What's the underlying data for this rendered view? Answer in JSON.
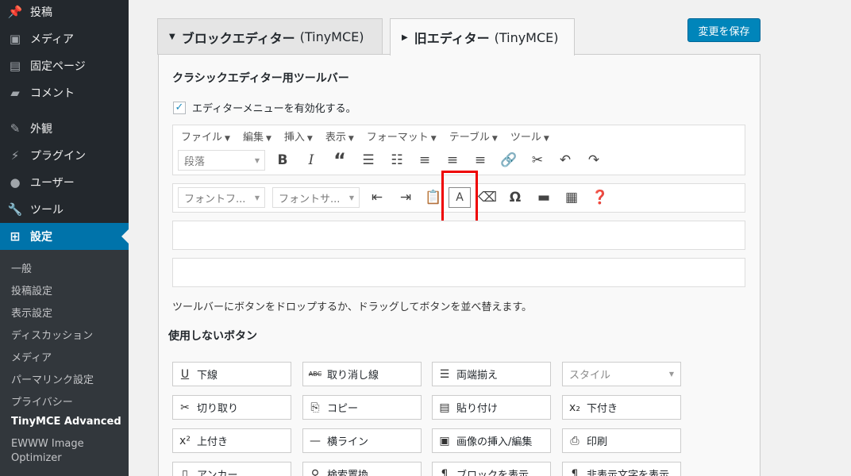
{
  "sidebar": {
    "items": [
      {
        "label": "投稿",
        "icon": "pin-icon"
      },
      {
        "label": "メディア",
        "icon": "media-icon"
      },
      {
        "label": "固定ページ",
        "icon": "page-icon"
      },
      {
        "label": "コメント",
        "icon": "comment-icon"
      },
      {
        "label": "外観",
        "icon": "brush-icon"
      },
      {
        "label": "プラグイン",
        "icon": "plugin-icon"
      },
      {
        "label": "ユーザー",
        "icon": "user-icon"
      },
      {
        "label": "ツール",
        "icon": "wrench-icon"
      },
      {
        "label": "設定",
        "icon": "settings-icon"
      }
    ],
    "submenu": [
      "一般",
      "投稿設定",
      "表示設定",
      "ディスカッション",
      "メディア",
      "パーマリンク設定",
      "プライバシー",
      "TinyMCE Advanced",
      "EWWW Image",
      "Optimizer"
    ]
  },
  "tabs": [
    {
      "label": "ブロックエディター",
      "sub": "(TinyMCE)"
    },
    {
      "label": "旧エディター",
      "sub": "(TinyMCE)"
    }
  ],
  "save_button": "変更を保存",
  "section_title": "クラシックエディター用ツールバー",
  "checkbox_label": "エディターメニューを有効化する。",
  "menubar": [
    "ファイル",
    "編集",
    "挿入",
    "表示",
    "フォーマット",
    "テーブル",
    "ツール"
  ],
  "toolbar1": {
    "format_select": "段落",
    "buttons": [
      "bold-icon",
      "italic-icon",
      "blockquote-icon",
      "bullet-list-icon",
      "numbered-list-icon",
      "align-left-icon",
      "align-center-icon",
      "align-right-icon",
      "link-icon",
      "unlink-icon",
      "undo-icon",
      "redo-icon"
    ]
  },
  "toolbar2": {
    "font_family_select": "フォントフ...",
    "font_size_select": "フォントサ...",
    "font_color_label": "A",
    "buttons": [
      "outdent-icon",
      "indent-icon",
      "paste-text-icon",
      "font-color-icon",
      "eraser-icon",
      "omega-icon",
      "hr-icon",
      "table-icon",
      "help-icon"
    ]
  },
  "help_text": "ツールバーにボタンをドロップするか、ドラッグしてボタンを並べ替えます。",
  "unused_title": "使用しないボタン",
  "unused_buttons": [
    {
      "label": "下線",
      "icon": "underline-icon",
      "glyph": "U"
    },
    {
      "label": "取り消し線",
      "icon": "strikethrough-icon",
      "glyph": "ABC"
    },
    {
      "label": "両端揃え",
      "icon": "justify-icon",
      "glyph": "☰"
    },
    {
      "label": "スタイル",
      "icon": "",
      "glyph": ""
    },
    {
      "label": "切り取り",
      "icon": "cut-icon",
      "glyph": "✂"
    },
    {
      "label": "コピー",
      "icon": "copy-icon",
      "glyph": "⎘"
    },
    {
      "label": "貼り付け",
      "icon": "paste-icon",
      "glyph": "📋"
    },
    {
      "label": "下付き",
      "icon": "subscript-icon",
      "glyph": "x₂"
    },
    {
      "label": "上付き",
      "icon": "superscript-icon",
      "glyph": "x²"
    },
    {
      "label": "横ライン",
      "icon": "hr-icon",
      "glyph": "—"
    },
    {
      "label": "画像の挿入/編集",
      "icon": "image-icon",
      "glyph": "▣"
    },
    {
      "label": "印刷",
      "icon": "print-icon",
      "glyph": "⎙"
    },
    {
      "label": "アンカー",
      "icon": "anchor-icon",
      "glyph": "▯"
    },
    {
      "label": "検索置換",
      "icon": "search-replace-icon",
      "glyph": "⚲"
    },
    {
      "label": "ブロックを表示",
      "icon": "show-blocks-icon",
      "glyph": "¶"
    },
    {
      "label": "非表示文字を表示",
      "icon": "invisible-chars-icon",
      "glyph": "¶"
    }
  ]
}
